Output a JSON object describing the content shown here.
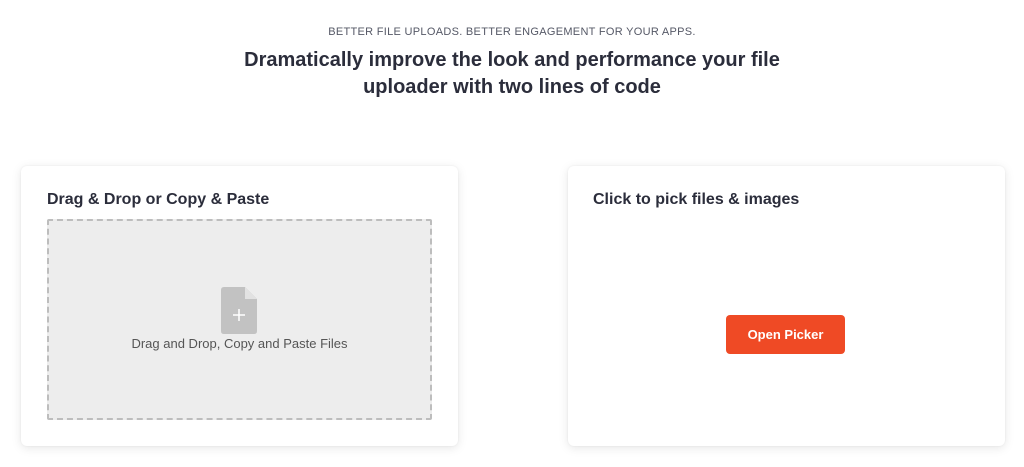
{
  "hero": {
    "eyebrow": "BETTER FILE UPLOADS. BETTER ENGAGEMENT FOR YOUR APPS.",
    "headline_line1": "Dramatically improve the look and performance your file",
    "headline_line2": "uploader with two lines of code"
  },
  "drop_card": {
    "title": "Drag & Drop or Copy & Paste",
    "dropzone_icon": "file-add-icon",
    "dropzone_text": "Drag and Drop, Copy and Paste Files"
  },
  "picker_card": {
    "title": "Click to pick files & images",
    "button_label": "Open Picker"
  },
  "colors": {
    "accent": "#ef4a25",
    "heading": "#2b2d3b",
    "dropzone_bg": "#ededed",
    "icon": "#c2c2c2"
  }
}
